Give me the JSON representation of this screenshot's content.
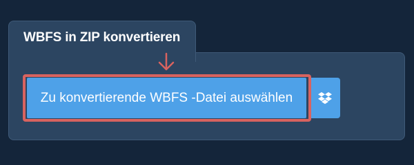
{
  "panel": {
    "tab_title": "WBFS in ZIP konvertieren"
  },
  "upload": {
    "select_button_label": "Zu konvertierende WBFS -Datei auswählen",
    "dropbox_icon": "dropbox-icon"
  },
  "annotation": {
    "arrow_icon": "arrow-down-icon",
    "highlight_color": "#d9635f"
  },
  "colors": {
    "background": "#14253a",
    "panel": "#2c4561",
    "button": "#4ea1e8"
  }
}
